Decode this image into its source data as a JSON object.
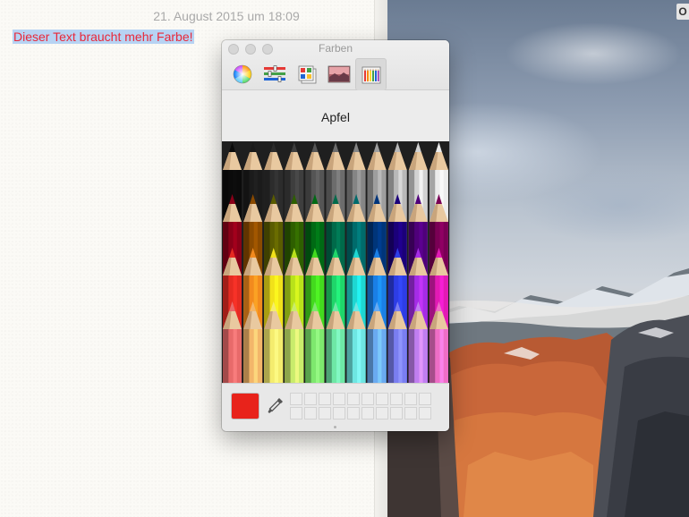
{
  "note": {
    "date": "21. August 2015 um 18:09",
    "selected_text": "Dieser Text braucht mehr Farbe!"
  },
  "desktop": {
    "corner_badge": "O"
  },
  "colors_panel": {
    "title": "Farben",
    "toolbar": [
      {
        "icon": "color-wheel-icon",
        "active": false
      },
      {
        "icon": "color-sliders-icon",
        "active": false
      },
      {
        "icon": "color-palettes-icon",
        "active": false
      },
      {
        "icon": "image-palettes-icon",
        "active": false
      },
      {
        "icon": "pencils-icon",
        "active": true
      }
    ],
    "palette_name": "Apfel",
    "current_color": "#e8231b",
    "pencil_rows": [
      [
        "#0b0b0b",
        "#1b1b1b",
        "#2c2c2c",
        "#3e3e3e",
        "#555555",
        "#6c6c6c",
        "#858585",
        "#9e9e9e",
        "#b8b8b8",
        "#d2d2d2",
        "#ececec"
      ],
      [
        "#8a0018",
        "#8a4a00",
        "#5a5c00",
        "#2e5f00",
        "#006a14",
        "#006a4a",
        "#006b6b",
        "#00357a",
        "#1b007a",
        "#4f007a",
        "#7a0055"
      ],
      [
        "#e52b22",
        "#f28a1e",
        "#f1e11a",
        "#b8e21a",
        "#43da1e",
        "#1fd66a",
        "#1ed7d2",
        "#1a7fe6",
        "#2d3de6",
        "#a52ce6",
        "#e21ab4"
      ],
      [
        "#e86a6a",
        "#f3b66a",
        "#f4ec6e",
        "#c9ec6c",
        "#7ee86e",
        "#6ee8a6",
        "#6ee6e2",
        "#6aaaf0",
        "#7a7ef0",
        "#c07ef0",
        "#ee6ec6"
      ]
    ],
    "custom_swatches_count": 20
  }
}
